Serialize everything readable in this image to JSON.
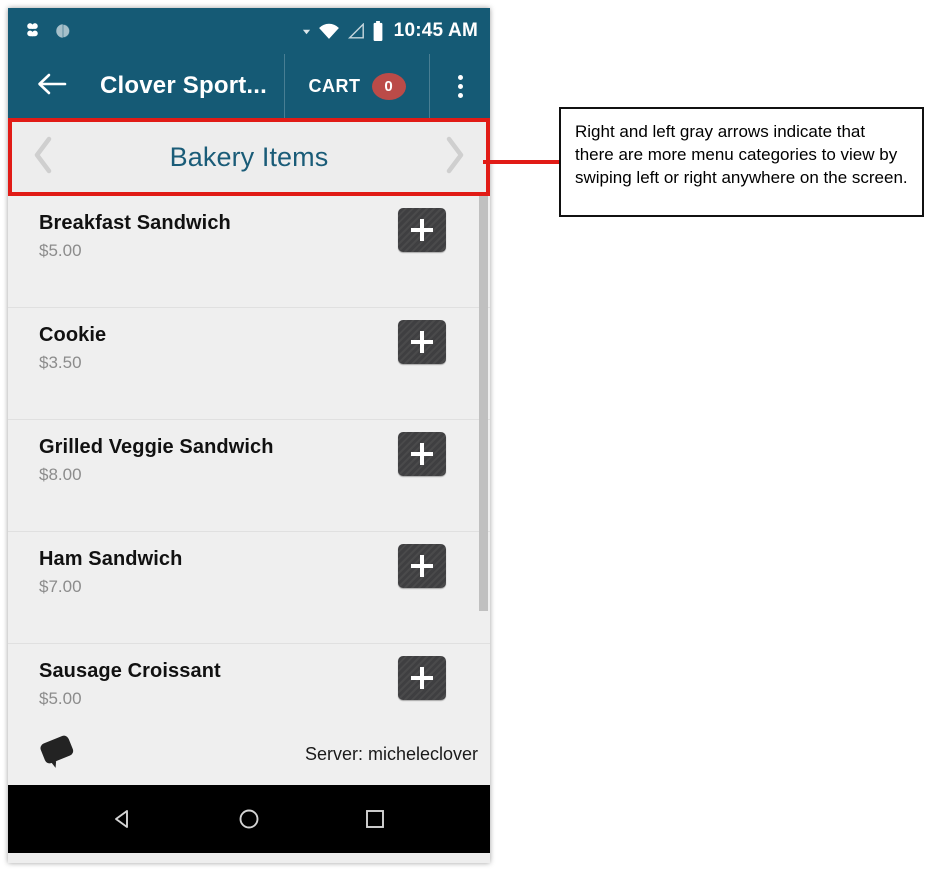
{
  "status_bar": {
    "icons": [
      "clover-logo-icon",
      "sync-circle-icon",
      "wifi-icon",
      "cell-signal-icon",
      "battery-icon"
    ],
    "time": "10:45 AM"
  },
  "app_bar": {
    "back_icon": "back-arrow-icon",
    "title": "Clover Sport...",
    "cart_label": "CART",
    "cart_count": "0",
    "overflow_icon": "overflow-menu-icon",
    "background_color": "#155A75",
    "badge_color": "#BB4B48"
  },
  "category_bar": {
    "prev_icon": "chevron-left-icon",
    "name": "Bakery Items",
    "next_icon": "chevron-right-icon",
    "text_color": "#1A5C78",
    "highlight_color": "#E11B16"
  },
  "items": [
    {
      "name": "Breakfast Sandwich",
      "price": "$5.00",
      "add_label": "+"
    },
    {
      "name": "Cookie",
      "price": "$3.50",
      "add_label": "+"
    },
    {
      "name": "Grilled Veggie Sandwich",
      "price": "$8.00",
      "add_label": "+"
    },
    {
      "name": "Ham Sandwich",
      "price": "$7.00",
      "add_label": "+"
    },
    {
      "name": "Sausage Croissant",
      "price": "$5.00",
      "add_label": "+"
    }
  ],
  "footer": {
    "tag_icon": "price-tag-icon",
    "server_text": "Server: micheleclover"
  },
  "nav_bar": {
    "back_icon": "nav-back-triangle-icon",
    "home_icon": "nav-home-circle-icon",
    "recents_icon": "nav-recents-square-icon"
  },
  "annotation": {
    "text": "Right and left gray arrows indicate that there are more menu categories to view by swiping left or right anywhere on the screen."
  }
}
